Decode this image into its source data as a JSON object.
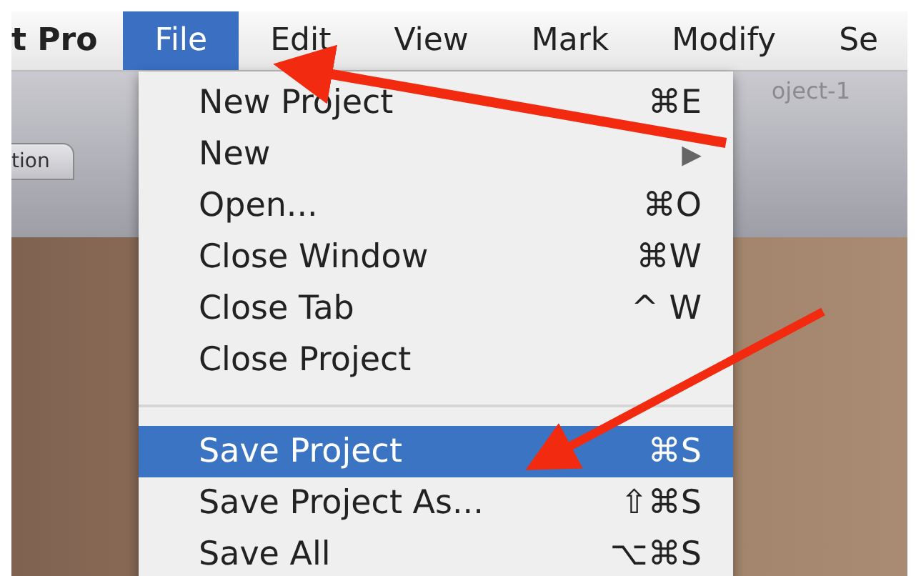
{
  "menubar": [
    {
      "label": "t Pro",
      "selected": false,
      "kind": "app"
    },
    {
      "label": "File",
      "selected": true,
      "kind": "menu"
    },
    {
      "label": "Edit",
      "selected": false,
      "kind": "menu"
    },
    {
      "label": "View",
      "selected": false,
      "kind": "menu"
    },
    {
      "label": "Mark",
      "selected": false,
      "kind": "menu"
    },
    {
      "label": "Modify",
      "selected": false,
      "kind": "menu"
    },
    {
      "label": "Se",
      "selected": false,
      "kind": "menu"
    }
  ],
  "window": {
    "title": "oject-1",
    "tab": "tion"
  },
  "file_menu": [
    {
      "kind": "item",
      "label": "New Project",
      "shortcut": "⌘E",
      "selected": false
    },
    {
      "kind": "submenu",
      "label": "New",
      "shortcut": "▶",
      "selected": false
    },
    {
      "kind": "item",
      "label": "Open...",
      "shortcut": "⌘O",
      "selected": false
    },
    {
      "kind": "item",
      "label": "Close Window",
      "shortcut": "⌘W",
      "selected": false
    },
    {
      "kind": "item",
      "label": "Close Tab",
      "shortcut": "^ W",
      "selected": false
    },
    {
      "kind": "item",
      "label": "Close Project",
      "selected": false
    },
    {
      "kind": "separator"
    },
    {
      "kind": "item",
      "label": "Save Project",
      "shortcut": "⌘S",
      "selected": true
    },
    {
      "kind": "item",
      "label": "Save Project As...",
      "shortcut": "⇧⌘S",
      "selected": false
    },
    {
      "kind": "item",
      "label": "Save All",
      "shortcut": "⌥⌘S",
      "selected": false
    }
  ]
}
